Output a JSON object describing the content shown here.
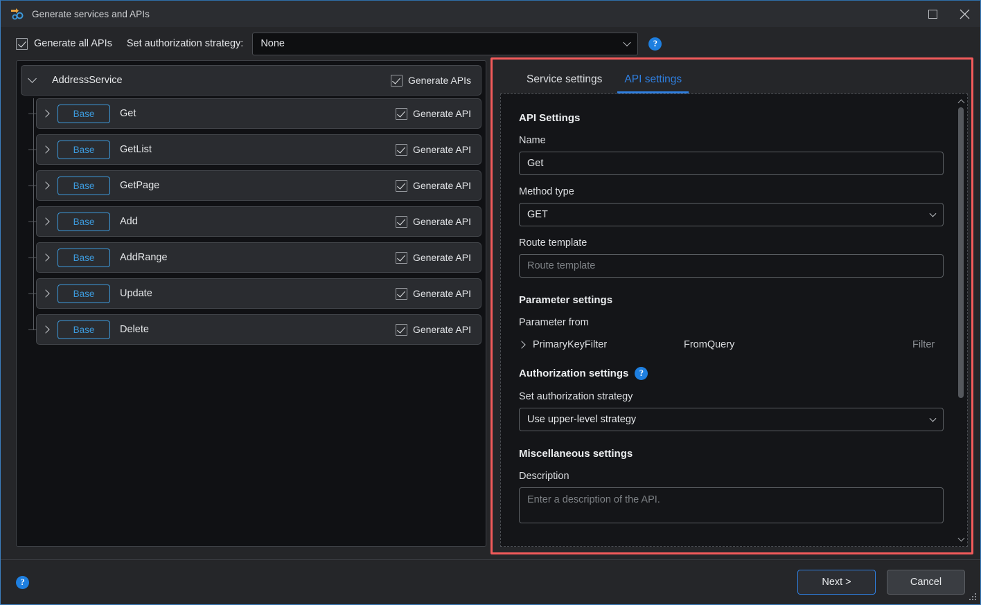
{
  "window": {
    "title": "Generate services and APIs",
    "icon": "generate-services-icon",
    "maximize_label": "Maximize",
    "close_label": "Close"
  },
  "topbar": {
    "generate_all_label": "Generate all APIs",
    "generate_all_checked": true,
    "strategy_label": "Set authorization strategy:",
    "strategy_value": "None",
    "help_glyph": "?"
  },
  "tree": {
    "root": {
      "name": "AddressService",
      "checkbox_label": "Generate APIs",
      "checked": true,
      "expanded": true
    },
    "items": [
      {
        "badge": "Base",
        "name": "Get",
        "checkbox_label": "Generate API",
        "checked": true
      },
      {
        "badge": "Base",
        "name": "GetList",
        "checkbox_label": "Generate API",
        "checked": true
      },
      {
        "badge": "Base",
        "name": "GetPage",
        "checkbox_label": "Generate API",
        "checked": true
      },
      {
        "badge": "Base",
        "name": "Add",
        "checkbox_label": "Generate API",
        "checked": true
      },
      {
        "badge": "Base",
        "name": "AddRange",
        "checkbox_label": "Generate API",
        "checked": true
      },
      {
        "badge": "Base",
        "name": "Update",
        "checkbox_label": "Generate API",
        "checked": true
      },
      {
        "badge": "Base",
        "name": "Delete",
        "checkbox_label": "Generate API",
        "checked": true
      }
    ]
  },
  "settings": {
    "tabs": [
      {
        "label": "Service settings",
        "active": false
      },
      {
        "label": "API settings",
        "active": true
      }
    ],
    "api_settings": {
      "heading": "API Settings",
      "name_label": "Name",
      "name_value": "Get",
      "method_label": "Method type",
      "method_value": "GET",
      "route_label": "Route template",
      "route_placeholder": "Route template",
      "route_value": ""
    },
    "parameter_settings": {
      "heading": "Parameter settings",
      "from_label": "Parameter from",
      "rows": [
        {
          "name": "PrimaryKeyFilter",
          "from": "FromQuery",
          "kind": "Filter"
        }
      ]
    },
    "authorization_settings": {
      "heading": "Authorization settings",
      "help_glyph": "?",
      "strategy_label": "Set authorization strategy",
      "strategy_value": "Use upper-level strategy"
    },
    "misc_settings": {
      "heading": "Miscellaneous settings",
      "description_label": "Description",
      "description_placeholder": "Enter a description of the API.",
      "description_value": ""
    }
  },
  "footer": {
    "help_glyph": "?",
    "next_label": "Next >",
    "cancel_label": "Cancel"
  },
  "colors": {
    "accent_blue": "#2f7fe0",
    "badge_blue": "#3d9bdd",
    "highlight_red": "#f35b5b",
    "window_bg": "#252629",
    "panel_bg": "#141518",
    "tree_bg": "#101114"
  }
}
